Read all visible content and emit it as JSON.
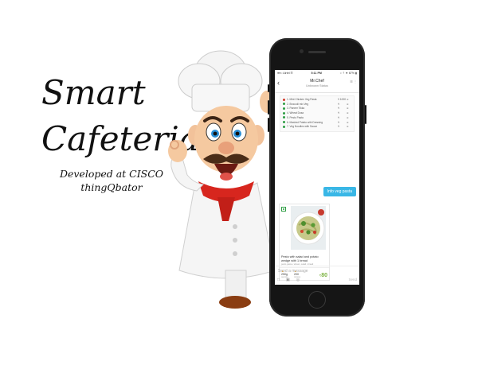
{
  "title": {
    "line1": "Smart",
    "line2": "Cafeteria"
  },
  "subtitle": {
    "line1": "Developed at CISCO",
    "line2": "thingQbator"
  },
  "phone": {
    "status": {
      "left": "●●○ Airtel ☶",
      "time": "5:11 PM",
      "right": "○ ⇡ ✷ 67% ▮"
    },
    "header": {
      "back": "‹",
      "name": "Mr.Chef",
      "status": "Unknown Status",
      "icons": "☰ ⋮"
    },
    "menu_items": [
      {
        "name": "1. Mint Chicken Veg Pasta",
        "price": "₹ 1000",
        "add": "⊕",
        "veg": false
      },
      {
        "name": "2. Broccoli mix Veg",
        "price": "₹",
        "add": "⊕",
        "veg": true
      },
      {
        "name": "3. Paneer Tikka",
        "price": "₹",
        "add": "⊕",
        "veg": true
      },
      {
        "name": "4. Wheat Dosa",
        "price": "₹",
        "add": "⊕",
        "veg": true
      },
      {
        "name": "5. Pesto Pasta",
        "price": "₹",
        "add": "⊕",
        "veg": true
      },
      {
        "name": "6. Mashed Potato with Dressing",
        "price": "₹",
        "add": "⊕",
        "veg": true
      },
      {
        "name": "7. Veg Noodles with Sauce",
        "price": "₹",
        "add": "⊕",
        "veg": true
      }
    ],
    "user_message": "Info veg pasta",
    "food_card": {
      "title": "Pesto with salad and potato wedge with 1 bread",
      "desc": "pesto pasta • wheat • salad • bread",
      "stat1_value": "250g",
      "stat1_label": "quantity",
      "stat2_value": "200",
      "stat2_label": "calories",
      "price_symbol": "₹",
      "price": "80"
    },
    "input_placeholder": "Send a message",
    "tool_icons": {
      "file": "□",
      "image": "▣",
      "camera": "◎"
    },
    "send_label": "Send"
  },
  "colors": {
    "user_bubble": "#39b7e6",
    "price": "#7cb342",
    "veg": "#2e9e44",
    "phone": "#151515"
  },
  "icons": [
    "chef-mascot-illustration",
    "pasta-dish-image",
    "veg-mark-icon",
    "back-chevron-icon"
  ]
}
